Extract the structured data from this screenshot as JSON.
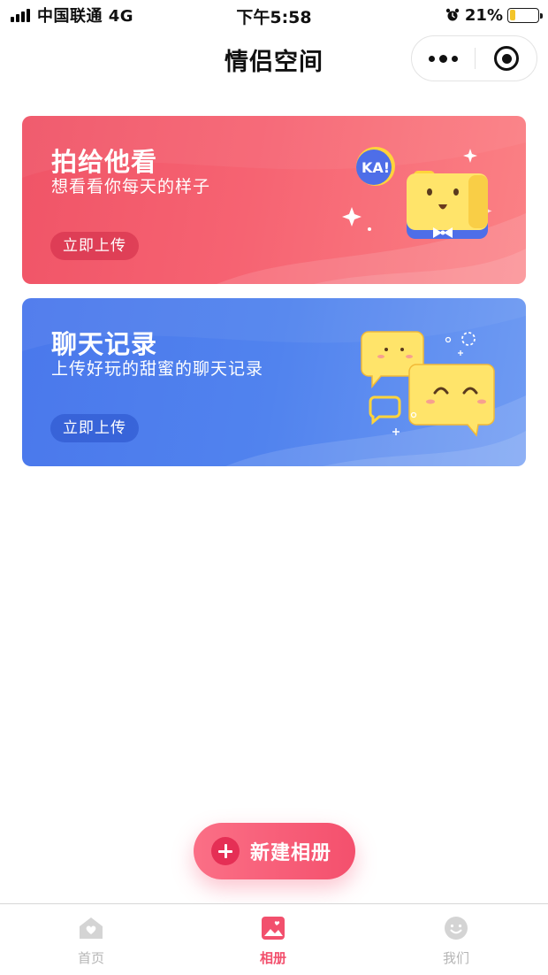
{
  "status_bar": {
    "carrier": "中国联通 4G",
    "time": "下午5:58",
    "battery_percent": "21%",
    "battery_level": 0.21,
    "icons": [
      "signal-icon",
      "alarm-icon",
      "battery-icon"
    ]
  },
  "nav": {
    "title": "情侣空间",
    "more_icon": "more-dots-icon",
    "close_icon": "record-circle-icon"
  },
  "cards": [
    {
      "title": "拍给他看",
      "subtitle": "想看看你每天的样子",
      "button": "立即上传",
      "badge_text": "KA!",
      "colors": {
        "from": "#f05467",
        "to": "#fb8185"
      }
    },
    {
      "title": "聊天记录",
      "subtitle": "上传好玩的甜蜜的聊天记录",
      "button": "立即上传",
      "colors": {
        "from": "#4a78ec",
        "to": "#6f9bf3"
      }
    }
  ],
  "fab": {
    "label": "新建相册",
    "icon": "plus-circle-icon",
    "color": "#f4506d"
  },
  "tabbar": {
    "items": [
      {
        "label": "首页",
        "icon": "home-heart-icon",
        "active": false
      },
      {
        "label": "相册",
        "icon": "album-icon",
        "active": true
      },
      {
        "label": "我们",
        "icon": "smile-face-icon",
        "active": false
      }
    ],
    "active_color": "#f2506d",
    "inactive_color": "#b5b5b5"
  }
}
